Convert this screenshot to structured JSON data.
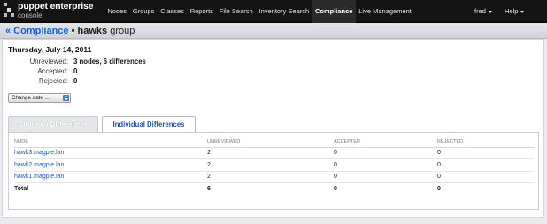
{
  "app": {
    "title": "puppet enterprise",
    "subtitle": "console"
  },
  "nav": {
    "items": [
      "Nodes",
      "Groups",
      "Classes",
      "Reports",
      "File Search",
      "Inventory Search",
      "Compliance",
      "Live Management"
    ],
    "active": "Compliance",
    "user_label": "fred",
    "help_label": "Help"
  },
  "header": {
    "back_label": "« Compliance",
    "separator": "•",
    "group_name": "hawks",
    "group_suffix": "group"
  },
  "summary": {
    "date": "Thursday, July 14, 2011",
    "rows": [
      {
        "label": "Unreviewed:",
        "value": "3 nodes, 6 differences"
      },
      {
        "label": "Accepted:",
        "value": "0"
      },
      {
        "label": "Rejected:",
        "value": "0"
      }
    ]
  },
  "change_date": {
    "label": "Change date ..."
  },
  "tabs": [
    {
      "label": "Common Differences",
      "active": false
    },
    {
      "label": "Individual Differences",
      "active": true
    }
  ],
  "table": {
    "columns": [
      "NODE",
      "UNREVIEWED",
      "ACCEPTED",
      "REJECTED"
    ],
    "rows": [
      {
        "node": "hawk3.magpie.lan",
        "unreviewed": "2",
        "accepted": "0",
        "rejected": "0"
      },
      {
        "node": "hawk2.magpie.lan",
        "unreviewed": "2",
        "accepted": "0",
        "rejected": "0"
      },
      {
        "node": "hawk1.magpie.lan",
        "unreviewed": "2",
        "accepted": "0",
        "rejected": "0"
      }
    ],
    "total": {
      "label": "Total",
      "unreviewed": "6",
      "accepted": "0",
      "rejected": "0"
    }
  },
  "colors": {
    "link": "#2255bb",
    "topbar": "#141414",
    "tab_active_text": "#2451a6"
  }
}
